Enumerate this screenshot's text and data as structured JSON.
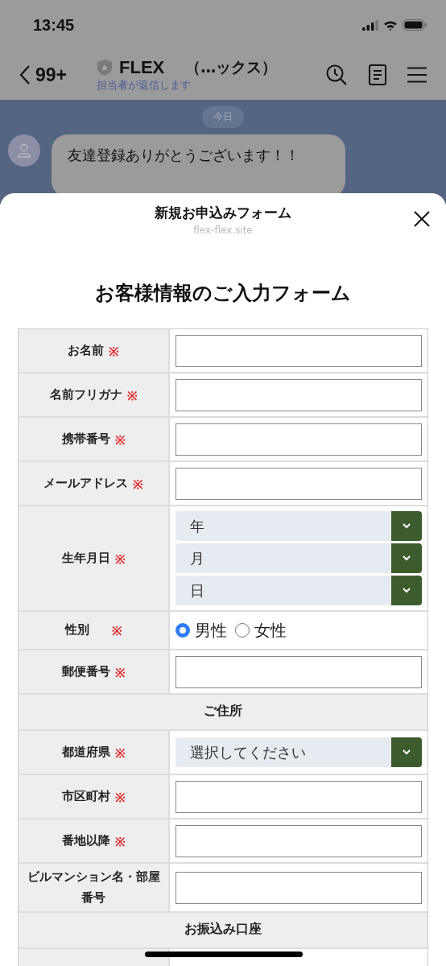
{
  "status_bar": {
    "time": "13:45"
  },
  "chat_header": {
    "back_count": "99+",
    "name": "FLEX",
    "name_suffix": "（…ックス）",
    "subtitle": "担当者が返信します"
  },
  "chat": {
    "date_chip": "今日",
    "message": "友達登録ありがとうございます！！"
  },
  "sheet": {
    "title": "新規お申込みフォーム",
    "domain": "flex-flex.site"
  },
  "form": {
    "heading": "お客様情報のご入力フォーム",
    "rows": [
      {
        "kind": "text",
        "label": "お名前",
        "required_mark": "※"
      },
      {
        "kind": "text",
        "label": "名前フリガナ",
        "required_mark": "※"
      },
      {
        "kind": "text",
        "label": "携帯番号",
        "required_mark": "※"
      },
      {
        "kind": "text",
        "label": "メールアドレス",
        "required_mark": "※"
      },
      {
        "kind": "selects",
        "label": "生年月日",
        "required_mark": "※",
        "selects": [
          "年",
          "月",
          "日"
        ]
      },
      {
        "kind": "radio",
        "label": "性別",
        "required_mark": "※",
        "options": [
          {
            "label": "男性",
            "selected": true
          },
          {
            "label": "女性",
            "selected": false
          }
        ]
      },
      {
        "kind": "text",
        "label": "郵便番号",
        "required_mark": "※"
      },
      {
        "kind": "section",
        "label": "ご住所"
      },
      {
        "kind": "selects",
        "label": "都道府県",
        "required_mark": "※",
        "selects": [
          "選択してください"
        ]
      },
      {
        "kind": "text",
        "label": "市区町村",
        "required_mark": "※"
      },
      {
        "kind": "text",
        "label": "番地以降",
        "required_mark": "※"
      },
      {
        "kind": "text",
        "label": "ビルマンション名・部屋番号"
      },
      {
        "kind": "section",
        "label": "お振込み口座"
      },
      {
        "kind": "empty"
      }
    ]
  }
}
